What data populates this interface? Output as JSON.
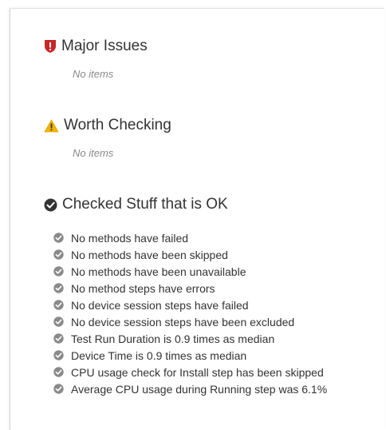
{
  "sections": {
    "major": {
      "title": "Major Issues",
      "empty_text": "No items",
      "icon": "shield-alert-icon",
      "color": "#c62828"
    },
    "worth": {
      "title": "Worth Checking",
      "empty_text": "No items",
      "icon": "warning-triangle-icon",
      "color": "#f0b400"
    },
    "ok": {
      "title": "Checked Stuff that is OK",
      "icon": "check-circle-icon",
      "color": "#333333",
      "item_icon": "check-circle-icon",
      "item_icon_color": "#8a8a8a",
      "items": [
        "No methods have failed",
        "No methods have been skipped",
        "No methods have been unavailable",
        "No method steps have errors",
        "No device session steps have failed",
        "No device session steps have been excluded",
        "Test Run Duration is 0.9 times as median",
        "Device Time is 0.9 times as median",
        "CPU usage check for Install step has been skipped",
        "Average CPU usage during Running step was 6.1%"
      ]
    }
  }
}
